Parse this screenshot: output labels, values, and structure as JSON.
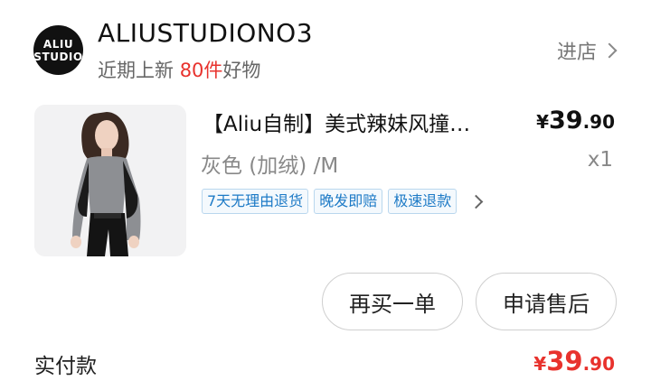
{
  "store": {
    "logo_line1": "ALIU",
    "logo_line2": "STUDIO",
    "name": "ALIUSTUDIONO3",
    "subtitle_prefix": "近期上新",
    "subtitle_count": "80件",
    "subtitle_suffix": "好物",
    "enter_label": "进店"
  },
  "product": {
    "title": "【Aliu自制】美式辣妹风撞…",
    "price_symbol": "¥",
    "price_integer": "39",
    "price_decimal": ".90",
    "spec": "灰色 (加绒) /M",
    "quantity": "x1",
    "tags": [
      "7天无理由退货",
      "晚发即赔",
      "极速退款"
    ]
  },
  "actions": {
    "rebuy_label": "再买一单",
    "aftersale_label": "申请售后"
  },
  "payment": {
    "label": "实付款",
    "symbol": "¥",
    "integer": "39",
    "decimal": ".90"
  },
  "colors": {
    "accent_red": "#e8322d",
    "tag_blue": "#1d7ac6"
  }
}
